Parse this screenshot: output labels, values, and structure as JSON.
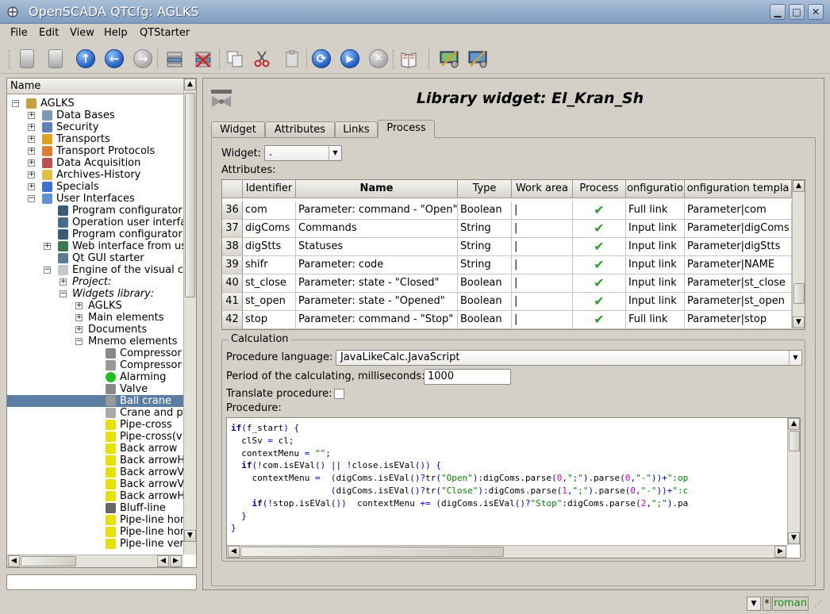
{
  "window": {
    "title": "OpenSCADA QTCfg: AGLKS",
    "min": "▁",
    "max": "□",
    "close": "✕"
  },
  "menu": [
    "File",
    "Edit",
    "View",
    "Help",
    "QTStarter"
  ],
  "toolbar": {
    "icons": [
      "db-load-icon",
      "db-save-icon",
      "up-icon",
      "back-icon",
      "forward-icon",
      "add-item-icon",
      "delete-item-icon",
      "copy-icon",
      "cut-icon",
      "paste-icon",
      "refresh-icon",
      "start-icon",
      "stop-icon",
      "help-icon",
      "program-configurator-icon",
      "program-configurator-icon-2"
    ],
    "up": "↑",
    "back": "←",
    "forward": "→",
    "refresh": "⟳",
    "start": "▶",
    "stop": "✕"
  },
  "tree": {
    "header": "Name",
    "items": [
      {
        "label": "AGLKS",
        "level": 0,
        "icon": "station-icon",
        "expand": "−"
      },
      {
        "label": "Data Bases",
        "level": 1,
        "icon": "database-icon",
        "expand": "+"
      },
      {
        "label": "Security",
        "level": 1,
        "icon": "security-icon",
        "expand": "+"
      },
      {
        "label": "Transports",
        "level": 1,
        "icon": "transports-icon",
        "expand": "+"
      },
      {
        "label": "Transport Protocols",
        "level": 1,
        "icon": "protocols-icon",
        "expand": "+"
      },
      {
        "label": "Data Acquisition",
        "level": 1,
        "icon": "data-acquisition-icon",
        "expand": "+"
      },
      {
        "label": "Archives-History",
        "level": 1,
        "icon": "archives-icon",
        "expand": "+"
      },
      {
        "label": "Specials",
        "level": 1,
        "icon": "specials-icon",
        "expand": "+"
      },
      {
        "label": "User Interfaces",
        "level": 1,
        "icon": "user-interfaces-icon",
        "expand": "−"
      },
      {
        "label": "Program configurator",
        "level": 2,
        "icon": "configurator-icon",
        "expand": ""
      },
      {
        "label": "Operation user interfa",
        "level": 2,
        "icon": "operation-ui-icon",
        "expand": ""
      },
      {
        "label": "Program configurator",
        "level": 2,
        "icon": "configurator-icon",
        "expand": ""
      },
      {
        "label": "Web interface from us",
        "level": 2,
        "icon": "web-interface-icon",
        "expand": "+"
      },
      {
        "label": "Qt GUI starter",
        "level": 2,
        "icon": "qt-starter-icon",
        "expand": ""
      },
      {
        "label": "Engine of the visual co",
        "level": 2,
        "icon": "vcs-engine-icon",
        "expand": "−"
      },
      {
        "label": "Project:",
        "level": 3,
        "icon": "",
        "expand": "+",
        "italic": true
      },
      {
        "label": "Widgets library:",
        "level": 3,
        "icon": "",
        "expand": "−",
        "italic": true
      },
      {
        "label": "AGLKS",
        "level": 4,
        "icon": "",
        "expand": "+"
      },
      {
        "label": "Main elements",
        "level": 4,
        "icon": "",
        "expand": "+"
      },
      {
        "label": "Documents",
        "level": 4,
        "icon": "",
        "expand": "+"
      },
      {
        "label": "Mnemo elements",
        "level": 4,
        "icon": "",
        "expand": "−"
      },
      {
        "label": "Compressor",
        "level": 5,
        "icon": "compressor-icon",
        "expand": ""
      },
      {
        "label": "Compressor",
        "level": 5,
        "icon": "compressor2-icon",
        "expand": ""
      },
      {
        "label": "Alarming",
        "level": 5,
        "icon": "alarming-icon",
        "expand": ""
      },
      {
        "label": "Valve",
        "level": 5,
        "icon": "valve-icon",
        "expand": ""
      },
      {
        "label": "Ball crane",
        "level": 5,
        "icon": "ball-crane-icon",
        "expand": "",
        "selected": true
      },
      {
        "label": "Crane and p",
        "level": 5,
        "icon": "crane-icon",
        "expand": ""
      },
      {
        "label": "Pipe-cross",
        "level": 5,
        "icon": "pipe-cross-icon",
        "expand": ""
      },
      {
        "label": "Pipe-cross(v",
        "level": 5,
        "icon": "pipe-cross-v-icon",
        "expand": ""
      },
      {
        "label": "Back arrow",
        "level": 5,
        "icon": "back-arrow-icon",
        "expand": ""
      },
      {
        "label": "Back arrowH",
        "level": 5,
        "icon": "back-arrow-h-icon",
        "expand": ""
      },
      {
        "label": "Back arrowV",
        "level": 5,
        "icon": "back-arrow-v-icon",
        "expand": ""
      },
      {
        "label": "Back arrowV",
        "level": 5,
        "icon": "back-arrow-v-icon",
        "expand": ""
      },
      {
        "label": "Back arrowH",
        "level": 5,
        "icon": "back-arrow-h-icon",
        "expand": ""
      },
      {
        "label": "Bluff-line",
        "level": 5,
        "icon": "bluff-line-icon",
        "expand": ""
      },
      {
        "label": "Pipe-line hor",
        "level": 5,
        "icon": "pipe-line-hor-icon",
        "expand": ""
      },
      {
        "label": "Pipe-line hor",
        "level": 5,
        "icon": "pipe-line-hor-icon",
        "expand": ""
      },
      {
        "label": "Pipe-line ver",
        "level": 5,
        "icon": "pipe-line-ver-icon",
        "expand": ""
      }
    ]
  },
  "main": {
    "title": "Library widget: El_Kran_Sh",
    "tabs": [
      "Widget",
      "Attributes",
      "Links",
      "Process"
    ],
    "active_tab": 3,
    "widget_label": "Widget:",
    "widget_value": ".",
    "attributes_label": "Attributes:",
    "table": {
      "columns": [
        "Identifier",
        "Name",
        "Type",
        "Work area",
        "Process",
        "onfiguratio",
        "onfiguration templa"
      ],
      "rows": [
        {
          "n": "36",
          "id": "com",
          "name": "Parameter: command - \"Open\"",
          "type": "Boolean",
          "wa": "|",
          "proc": "✔",
          "cfg": "Full link",
          "tmpl": "Parameter|com"
        },
        {
          "n": "37",
          "id": "digComs",
          "name": "Commands",
          "type": "String",
          "wa": "|",
          "proc": "✔",
          "cfg": "Input link",
          "tmpl": "Parameter|digComs"
        },
        {
          "n": "38",
          "id": "digStts",
          "name": "Statuses",
          "type": "String",
          "wa": "|",
          "proc": "✔",
          "cfg": "Input link",
          "tmpl": "Parameter|digStts"
        },
        {
          "n": "39",
          "id": "shifr",
          "name": "Parameter: code",
          "type": "String",
          "wa": "|",
          "proc": "✔",
          "cfg": "Input link",
          "tmpl": "Parameter|NAME"
        },
        {
          "n": "40",
          "id": "st_close",
          "name": "Parameter: state - \"Closed\"",
          "type": "Boolean",
          "wa": "|",
          "proc": "✔",
          "cfg": "Input link",
          "tmpl": "Parameter|st_close"
        },
        {
          "n": "41",
          "id": "st_open",
          "name": "Parameter: state - \"Opened\"",
          "type": "Boolean",
          "wa": "|",
          "proc": "✔",
          "cfg": "Input link",
          "tmpl": "Parameter|st_open"
        },
        {
          "n": "42",
          "id": "stop",
          "name": "Parameter: command - \"Stop\"",
          "type": "Boolean",
          "wa": "|",
          "proc": "✔",
          "cfg": "Full link",
          "tmpl": "Parameter|stop"
        }
      ]
    },
    "calc": {
      "group_title": "Calculation",
      "lang_label": "Procedure language:",
      "lang_value": "JavaLikeCalc.JavaScript",
      "period_label": "Period of the calculating, milliseconds:",
      "period_value": "1000",
      "translate_label": "Translate procedure:",
      "procedure_label": "Procedure:",
      "code": [
        "if(f_start) {",
        "  clSv = cl;",
        "  contextMenu = \"\";",
        "  if(!com.isEVal() || !close.isEVal()) {",
        "    contextMenu =  (digComs.isEVal()?tr(\"Open\"):digComs.parse(0,\";\").parse(0,\"-\"))+\":op",
        "                   (digComs.isEVal()?tr(\"Close\"):digComs.parse(1,\";\").parse(0,\"-\"))+\":c",
        "    if(!stop.isEVal())  contextMenu += (digComs.isEVal()?\"Stop\":digComs.parse(2,\";\").pa",
        "  }",
        "}"
      ]
    }
  },
  "status": {
    "user": "roman",
    "dropdown": "▼",
    "star": "*"
  }
}
